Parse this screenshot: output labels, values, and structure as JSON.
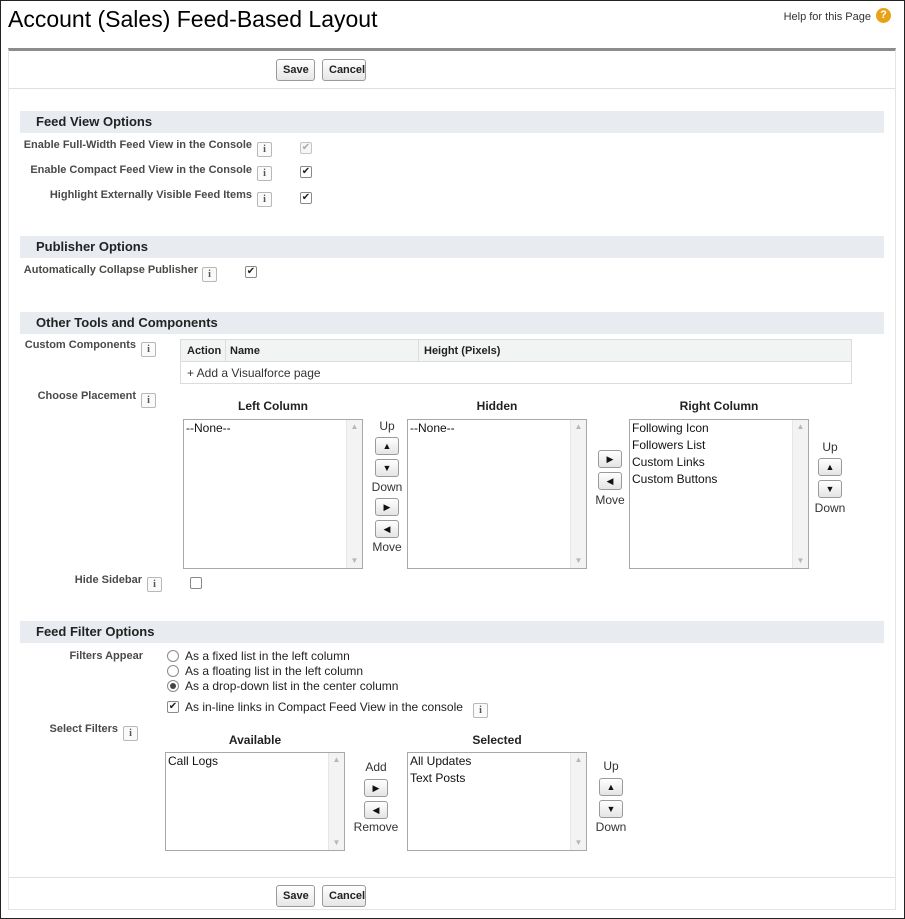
{
  "page": {
    "title": "Account (Sales) Feed-Based Layout",
    "help_link": "Help for this Page",
    "help_icon": "help-icon"
  },
  "buttons": {
    "save": "Save",
    "cancel": "Cancel"
  },
  "info_icon_glyph": "i",
  "feed_view": {
    "header": "Feed View Options",
    "full_width_label": "Enable Full-Width Feed View in the Console",
    "full_width_checked": true,
    "full_width_disabled": true,
    "compact_label": "Enable Compact Feed View in the Console",
    "compact_checked": true,
    "highlight_label": "Highlight Externally Visible Feed Items",
    "highlight_checked": true
  },
  "publisher": {
    "header": "Publisher Options",
    "collapse_label": "Automatically Collapse Publisher",
    "collapse_checked": true
  },
  "other_tools": {
    "header": "Other Tools and Components",
    "custom_components_label": "Custom Components",
    "table_headers": [
      "Action",
      "Name",
      "Height (Pixels)"
    ],
    "add_visualforce": "+ Add a Visualforce page",
    "choose_placement_label": "Choose Placement",
    "left_column_title": "Left Column",
    "left_column_items": [
      "--None--"
    ],
    "hidden_title": "Hidden",
    "hidden_items": [
      "--None--"
    ],
    "right_column_title": "Right Column",
    "right_column_items": [
      "Following Icon",
      "Followers List",
      "Custom Links",
      "Custom Buttons"
    ],
    "up_label": "Up",
    "down_label": "Down",
    "move_label": "Move",
    "hide_sidebar_label": "Hide Sidebar",
    "hide_sidebar_checked": false
  },
  "feed_filter": {
    "header": "Feed Filter Options",
    "filters_appear_label": "Filters Appear",
    "options": [
      "As a fixed list in the left column",
      "As a floating list in the left column",
      "As a drop-down list in the center column"
    ],
    "selected_option_index": 2,
    "inline_links_label": "As in-line links in Compact Feed View in the console",
    "inline_links_checked": true,
    "select_filters_label": "Select Filters",
    "available_title": "Available",
    "available_items": [
      "Call Logs"
    ],
    "selected_title": "Selected",
    "selected_items": [
      "All Updates",
      "Text Posts"
    ],
    "add_label": "Add",
    "remove_label": "Remove",
    "up_label": "Up",
    "down_label": "Down"
  }
}
